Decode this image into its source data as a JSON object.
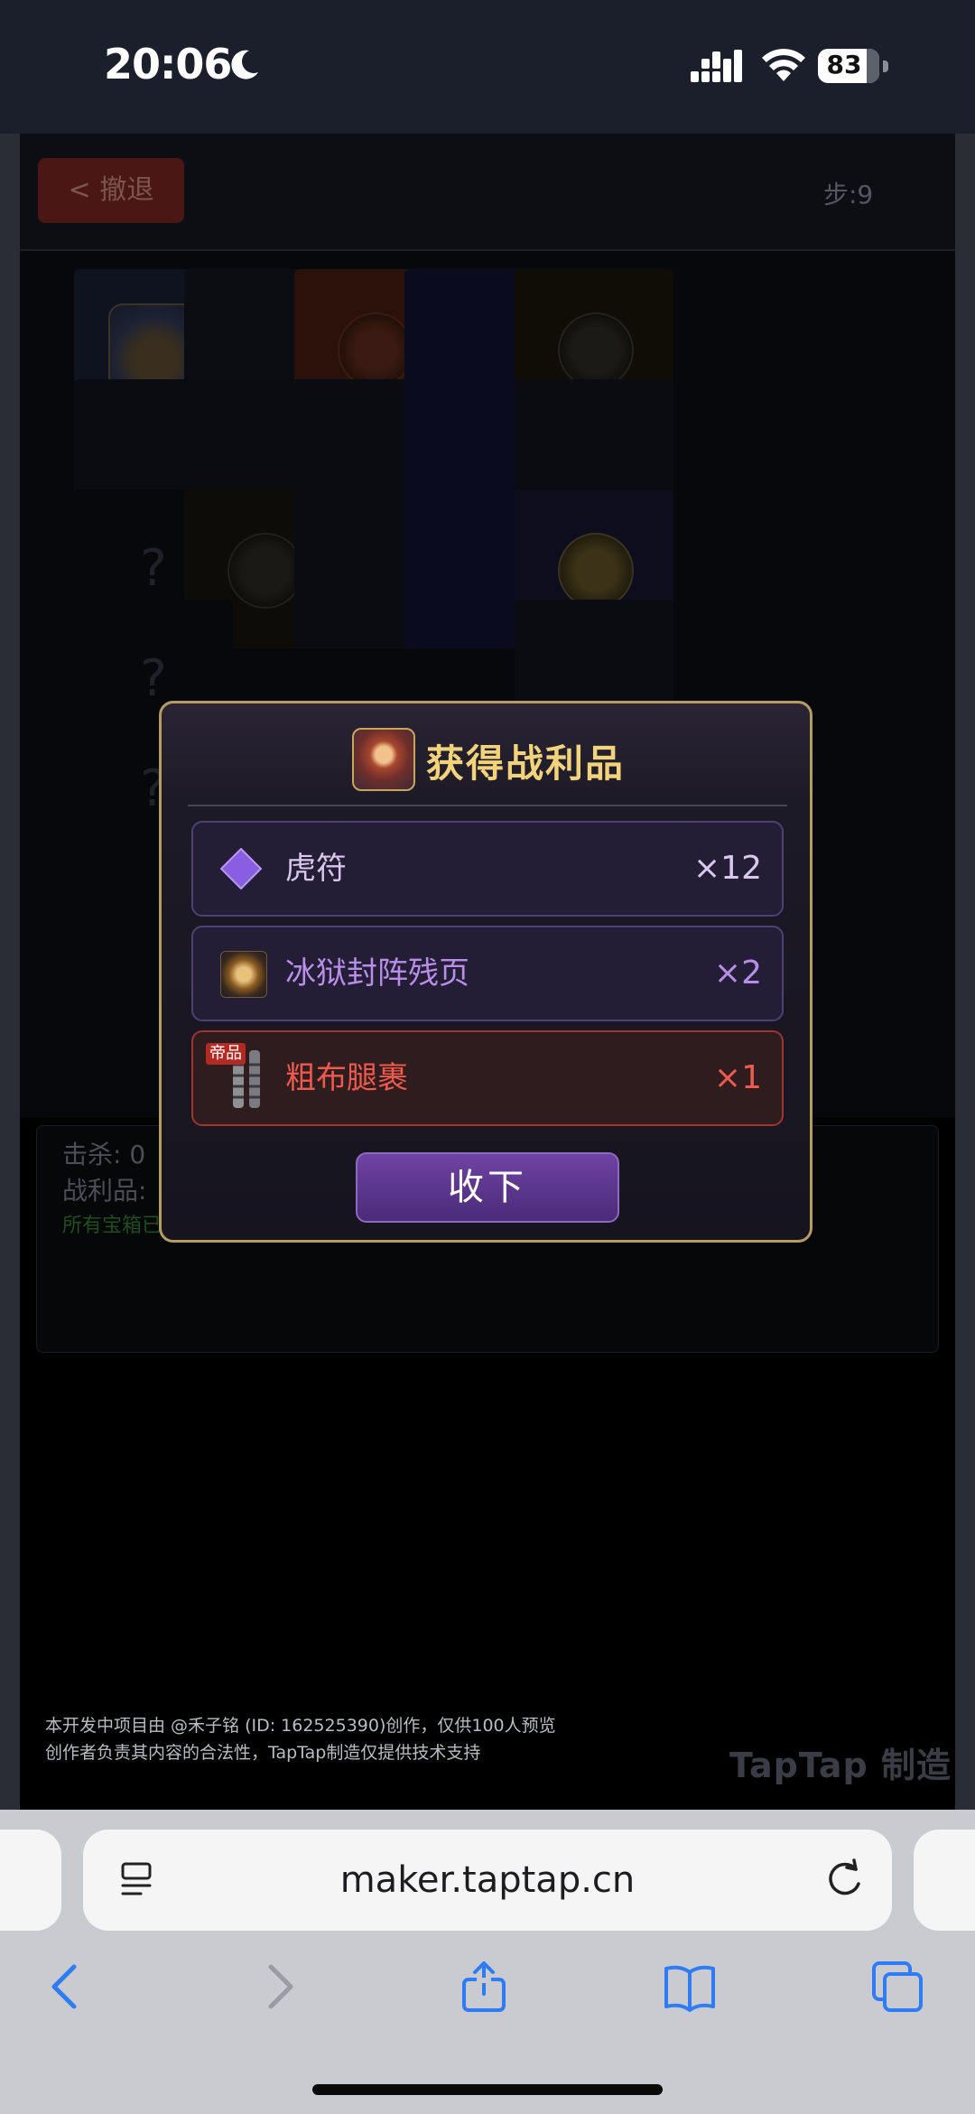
{
  "status_bar": {
    "time": "20:06",
    "battery": "83"
  },
  "game": {
    "undo_label": "< 撤退",
    "steps": "步:9",
    "stats": {
      "kills": "击杀: 0",
      "loot": "战利品:",
      "chest_note": "所有宝箱已开启"
    }
  },
  "modal": {
    "title": "获得战利品",
    "items": [
      {
        "name": "虎符",
        "qty": "×12",
        "icon": "diamond-icon",
        "color": "#d9c8ee"
      },
      {
        "name": "冰狱封阵残页",
        "qty": "×2",
        "icon": "scroll-icon",
        "color": "#b88ee8"
      },
      {
        "name": "粗布腿裹",
        "qty": "×1",
        "icon": "leg-wraps-icon",
        "color": "#ee5a4c",
        "tag": "帝品"
      }
    ],
    "confirm_label": "收下"
  },
  "footer": {
    "line1": "本开发中项目由 @禾子铭 (ID: 162525390)创作，仅供100人预览",
    "line2": "创作者负责其内容的合法性，TapTap制造仅提供技术支持",
    "watermark": "TapTap 制造"
  },
  "browser": {
    "url": "maker.taptap.cn"
  },
  "colors": {
    "accent_gold": "#f2d27a",
    "button_purple": "#5b3590",
    "epic_red": "#ee5a4c"
  }
}
